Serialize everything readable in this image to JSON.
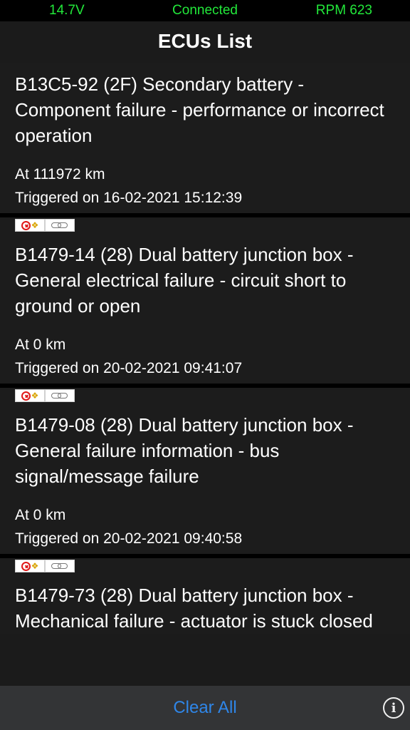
{
  "status_bar": {
    "voltage": "14.7V",
    "connection": "Connected",
    "rpm": "RPM 623"
  },
  "header": {
    "title": "ECUs List"
  },
  "dtc_list": [
    {
      "description": "B13C5-92 (2F) Secondary battery - Component failure - performance or incorrect operation",
      "distance": "At 111972 km",
      "triggered": "Triggered on 16-02-2021 15:12:39"
    },
    {
      "description": "B1479-14 (28) Dual battery junction box - General electrical failure - circuit short to ground or open",
      "distance": "At 0 km",
      "triggered": "Triggered on 20-02-2021 09:41:07"
    },
    {
      "description": "B1479-08 (28) Dual battery junction box - General failure information - bus signal/message failure",
      "distance": "At 0 km",
      "triggered": "Triggered on 20-02-2021 09:40:58"
    },
    {
      "description": "B1479-73 (28) Dual battery junction box - Mechanical failure - actuator is stuck closed",
      "distance": "",
      "triggered": ""
    }
  ],
  "icons": {
    "clear": "clear-code-icon",
    "link": "chain-link-icon",
    "info": "info-icon"
  },
  "footer": {
    "clear_all_label": "Clear All",
    "info_glyph": "i"
  },
  "colors": {
    "status_text": "#22e83a",
    "accent": "#2f86e8",
    "background": "#1b1b1b",
    "bottom_bar": "#333436"
  }
}
